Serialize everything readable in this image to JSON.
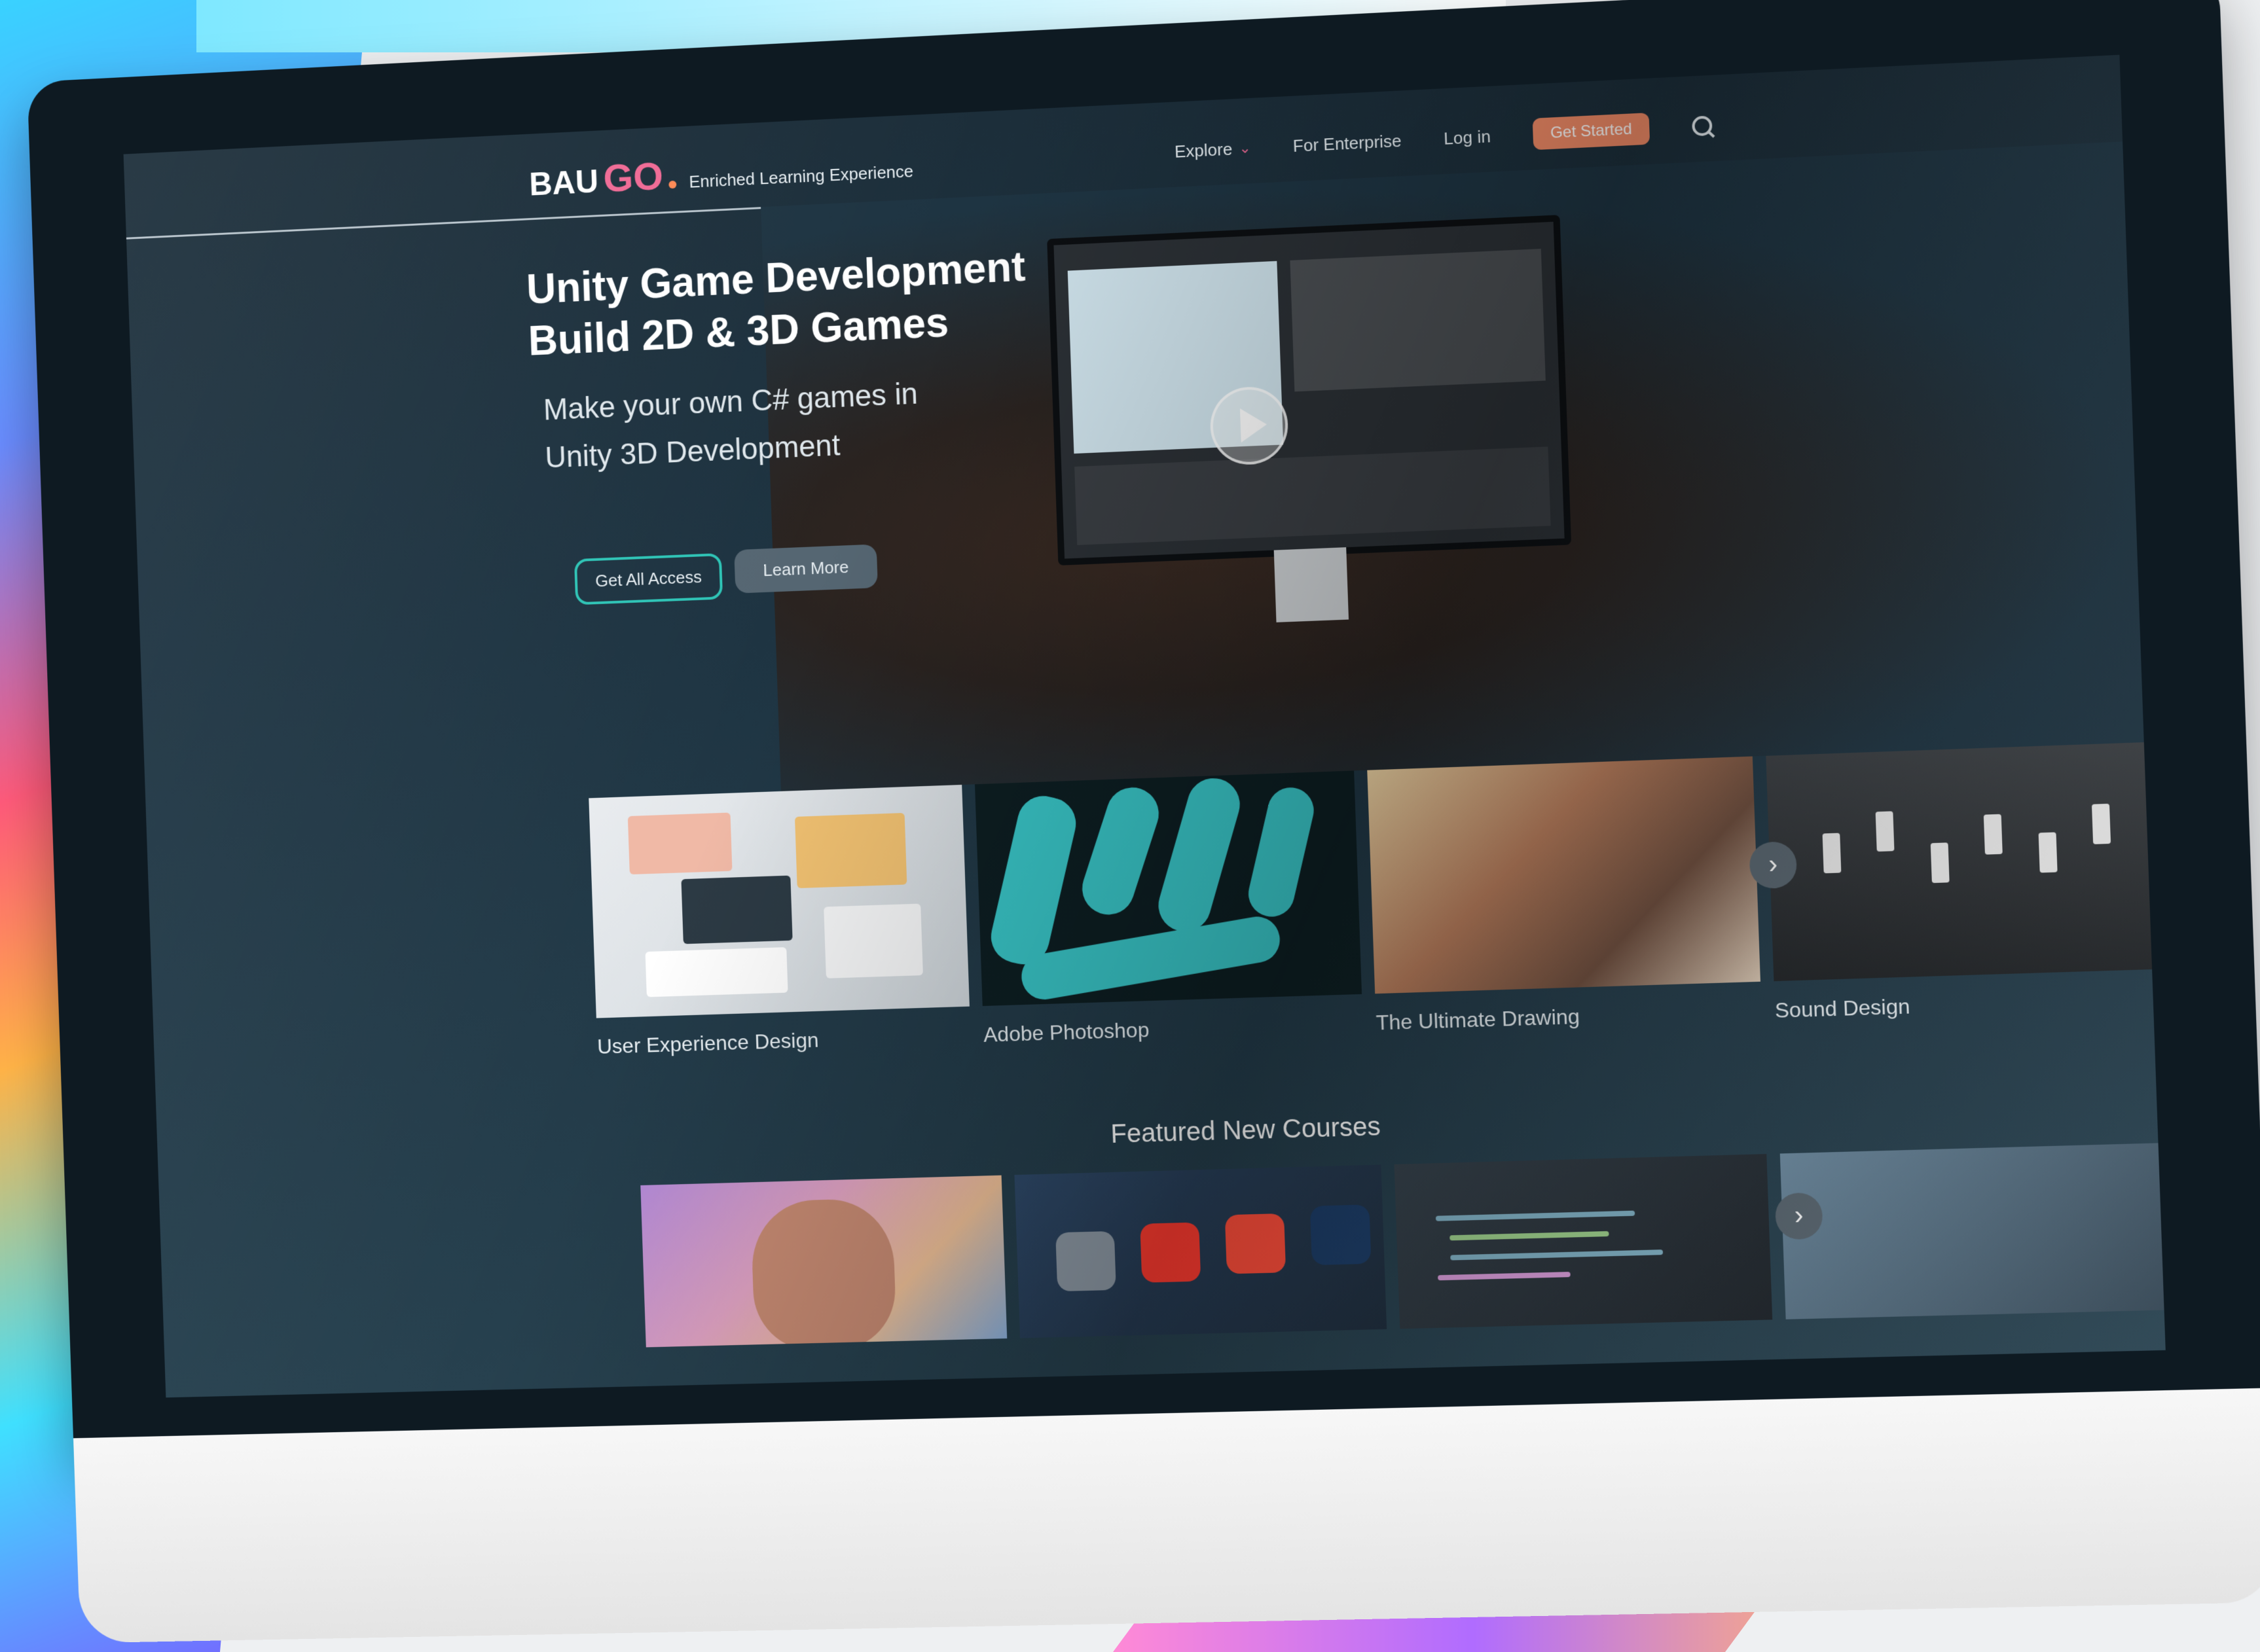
{
  "logo": {
    "brand_first": "BAU",
    "brand_second": "GO",
    "tagline": "Enriched Learning Experience"
  },
  "nav": {
    "explore": "Explore",
    "enterprise": "For Enterprise",
    "login": "Log in",
    "get_started": "Get Started"
  },
  "hero": {
    "title_line1": "Unity Game Development",
    "title_line2": "Build 2D & 3D Games",
    "sub_line1": "Make your own C# games in",
    "sub_line2": "Unity 3D Development",
    "btn_access": "Get All Access",
    "btn_learn": "Learn More"
  },
  "courses": [
    {
      "title": "User Experience Design"
    },
    {
      "title": "Adobe Photoshop"
    },
    {
      "title": "The Ultimate Drawing"
    },
    {
      "title": "Sound Design"
    }
  ],
  "featured": {
    "heading": "Featured New Courses"
  },
  "colors": {
    "accent_pink": "#f06a95",
    "accent_orange": "#ef8a66",
    "accent_teal": "#2ec4b6",
    "screen_bg": "#1e3442"
  },
  "icons": [
    "chevron-down-icon",
    "search-icon",
    "play-icon",
    "chevron-right-icon"
  ]
}
